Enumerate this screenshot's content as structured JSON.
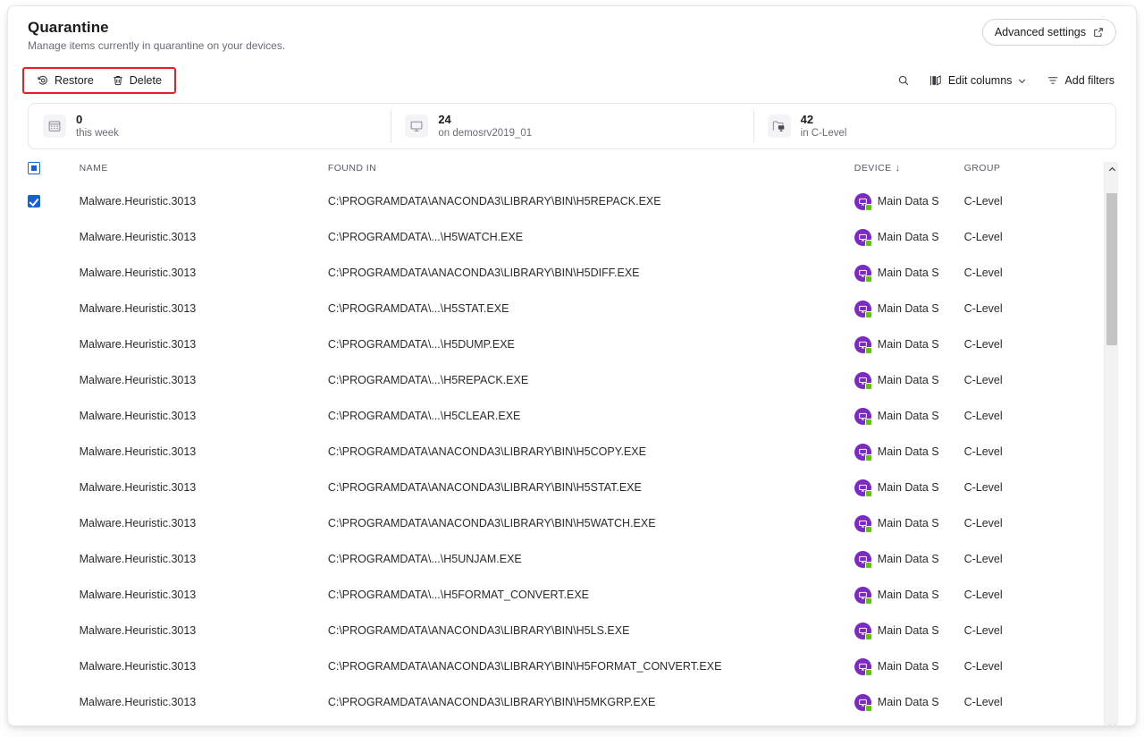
{
  "header": {
    "title": "Quarantine",
    "subtitle": "Manage items currently in quarantine on your devices.",
    "advanced_settings_label": "Advanced settings",
    "advanced_settings_icon": "external-link-icon"
  },
  "toolbar": {
    "restore_label": "Restore",
    "restore_icon": "restore-icon",
    "delete_label": "Delete",
    "delete_icon": "trash-icon",
    "highlight_color": "#ee1c25",
    "search_icon": "search-icon",
    "edit_columns_label": "Edit columns",
    "edit_columns_icon": "columns-icon",
    "edit_columns_chevron": "chevron-down-icon",
    "add_filters_label": "Add filters",
    "add_filters_icon": "filter-icon"
  },
  "stats": [
    {
      "value": "0",
      "label": "this week",
      "icon": "calendar-icon"
    },
    {
      "value": "24",
      "label": "on demosrv2019_01",
      "icon": "monitor-icon"
    },
    {
      "value": "42",
      "label": "in C-Level",
      "icon": "folder-device-icon"
    }
  ],
  "table": {
    "select_all_state": "indeterminate",
    "columns": [
      {
        "key": "name",
        "label": "NAME"
      },
      {
        "key": "found",
        "label": "FOUND IN"
      },
      {
        "key": "device",
        "label": "DEVICE",
        "sorted": "asc",
        "sort_glyph": "↓"
      },
      {
        "key": "group",
        "label": "GROUP"
      }
    ],
    "device_avatar": {
      "icon": "monitor-icon",
      "circle_color": "#7b2bbe",
      "status_color": "#63c216"
    },
    "rows": [
      {
        "selected": true,
        "name": "Malware.Heuristic.3013",
        "found": "C:\\PROGRAMDATA\\ANACONDA3\\LIBRARY\\BIN\\H5REPACK.EXE",
        "device": "Main Data S",
        "group": "C-Level"
      },
      {
        "selected": false,
        "name": "Malware.Heuristic.3013",
        "found": "C:\\PROGRAMDATA\\...\\H5WATCH.EXE",
        "device": "Main Data S",
        "group": "C-Level"
      },
      {
        "selected": false,
        "name": "Malware.Heuristic.3013",
        "found": "C:\\PROGRAMDATA\\ANACONDA3\\LIBRARY\\BIN\\H5DIFF.EXE",
        "device": "Main Data S",
        "group": "C-Level"
      },
      {
        "selected": false,
        "name": "Malware.Heuristic.3013",
        "found": "C:\\PROGRAMDATA\\...\\H5STAT.EXE",
        "device": "Main Data S",
        "group": "C-Level"
      },
      {
        "selected": false,
        "name": "Malware.Heuristic.3013",
        "found": "C:\\PROGRAMDATA\\...\\H5DUMP.EXE",
        "device": "Main Data S",
        "group": "C-Level"
      },
      {
        "selected": false,
        "name": "Malware.Heuristic.3013",
        "found": "C:\\PROGRAMDATA\\...\\H5REPACK.EXE",
        "device": "Main Data S",
        "group": "C-Level"
      },
      {
        "selected": false,
        "name": "Malware.Heuristic.3013",
        "found": "C:\\PROGRAMDATA\\...\\H5CLEAR.EXE",
        "device": "Main Data S",
        "group": "C-Level"
      },
      {
        "selected": false,
        "name": "Malware.Heuristic.3013",
        "found": "C:\\PROGRAMDATA\\ANACONDA3\\LIBRARY\\BIN\\H5COPY.EXE",
        "device": "Main Data S",
        "group": "C-Level"
      },
      {
        "selected": false,
        "name": "Malware.Heuristic.3013",
        "found": "C:\\PROGRAMDATA\\ANACONDA3\\LIBRARY\\BIN\\H5STAT.EXE",
        "device": "Main Data S",
        "group": "C-Level"
      },
      {
        "selected": false,
        "name": "Malware.Heuristic.3013",
        "found": "C:\\PROGRAMDATA\\ANACONDA3\\LIBRARY\\BIN\\H5WATCH.EXE",
        "device": "Main Data S",
        "group": "C-Level"
      },
      {
        "selected": false,
        "name": "Malware.Heuristic.3013",
        "found": "C:\\PROGRAMDATA\\...\\H5UNJAM.EXE",
        "device": "Main Data S",
        "group": "C-Level"
      },
      {
        "selected": false,
        "name": "Malware.Heuristic.3013",
        "found": "C:\\PROGRAMDATA\\...\\H5FORMAT_CONVERT.EXE",
        "device": "Main Data S",
        "group": "C-Level"
      },
      {
        "selected": false,
        "name": "Malware.Heuristic.3013",
        "found": "C:\\PROGRAMDATA\\ANACONDA3\\LIBRARY\\BIN\\H5LS.EXE",
        "device": "Main Data S",
        "group": "C-Level"
      },
      {
        "selected": false,
        "name": "Malware.Heuristic.3013",
        "found": "C:\\PROGRAMDATA\\ANACONDA3\\LIBRARY\\BIN\\H5FORMAT_CONVERT.EXE",
        "device": "Main Data S",
        "group": "C-Level"
      },
      {
        "selected": false,
        "name": "Malware.Heuristic.3013",
        "found": "C:\\PROGRAMDATA\\ANACONDA3\\LIBRARY\\BIN\\H5MKGRP.EXE",
        "device": "Main Data S",
        "group": "C-Level"
      }
    ]
  },
  "scrollbar": {
    "up_icon": "chevron-up-icon",
    "down_icon": "chevron-down-icon",
    "thumb_top_pct": 3,
    "thumb_height_pct": 28
  }
}
